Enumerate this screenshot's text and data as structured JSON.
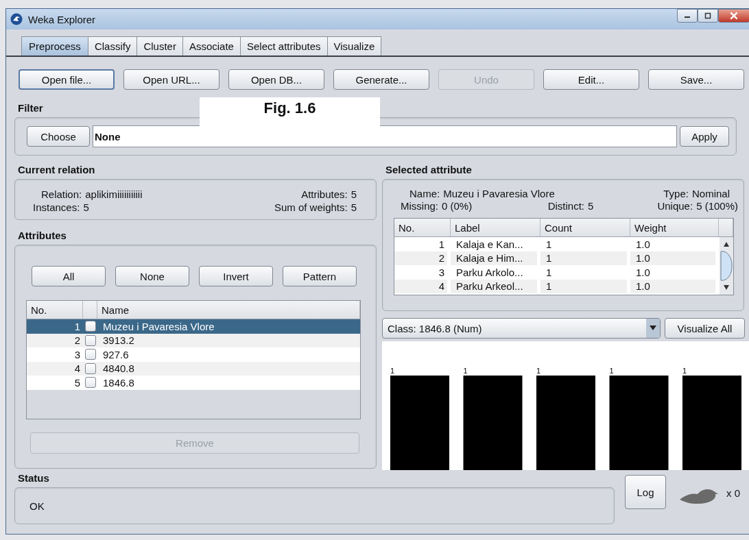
{
  "window": {
    "title": "Weka Explorer"
  },
  "tabs": [
    {
      "label": "Preprocess",
      "selected": true
    },
    {
      "label": "Classify",
      "selected": false
    },
    {
      "label": "Cluster",
      "selected": false
    },
    {
      "label": "Associate",
      "selected": false
    },
    {
      "label": "Select attributes",
      "selected": false
    },
    {
      "label": "Visualize",
      "selected": false
    }
  ],
  "toolbar_buttons": [
    {
      "label": "Open file...",
      "disabled": false
    },
    {
      "label": "Open URL...",
      "disabled": false
    },
    {
      "label": "Open DB...",
      "disabled": false
    },
    {
      "label": "Generate...",
      "disabled": false
    },
    {
      "label": "Undo",
      "disabled": true
    },
    {
      "label": "Edit...",
      "disabled": false
    },
    {
      "label": "Save...",
      "disabled": false
    }
  ],
  "figure_label": "Fig. 1.6",
  "filter": {
    "heading": "Filter",
    "choose_button": "Choose",
    "value": "None",
    "apply_button": "Apply"
  },
  "current_relation": {
    "heading": "Current relation",
    "fields": [
      {
        "label": "Relation:",
        "value": "aplikimiiiiiiiiiii"
      },
      {
        "label": "Attributes:",
        "value": "5"
      },
      {
        "label": "Instances:",
        "value": "5"
      },
      {
        "label": "Sum of weights:",
        "value": "5"
      }
    ]
  },
  "attributes": {
    "heading": "Attributes",
    "buttons": [
      "All",
      "None",
      "Invert",
      "Pattern"
    ],
    "columns": [
      "No.",
      "Name"
    ],
    "rows": [
      {
        "no": "1",
        "name": "Muzeu i Pavaresia Vlore",
        "checked": false,
        "selected": true
      },
      {
        "no": "2",
        "name": "3913.2",
        "checked": false,
        "selected": false
      },
      {
        "no": "3",
        "name": "927.6",
        "checked": false,
        "selected": false
      },
      {
        "no": "4",
        "name": "4840.8",
        "checked": false,
        "selected": false
      },
      {
        "no": "5",
        "name": "1846.8",
        "checked": false,
        "selected": false
      }
    ],
    "remove_button": {
      "label": "Remove",
      "disabled": true
    }
  },
  "selected_attribute": {
    "heading": "Selected attribute",
    "fields": [
      {
        "label": "Name:",
        "value": "Muzeu i Pavaresia Vlore"
      },
      {
        "label": "Type:",
        "value": "Nominal"
      },
      {
        "label": "Missing:",
        "value": "0 (0%)"
      },
      {
        "label": "Distinct:",
        "value": "5"
      },
      {
        "label": "Unique:",
        "value": "5 (100%)"
      }
    ],
    "columns": [
      "No.",
      "Label",
      "Count",
      "Weight"
    ],
    "rows": [
      [
        "1",
        "Kalaja e Kan...",
        "1",
        "1.0"
      ],
      [
        "2",
        "Kalaja e Him...",
        "1",
        "1.0"
      ],
      [
        "3",
        "Parku Arkolo...",
        "1",
        "1.0"
      ],
      [
        "4",
        "Parku Arkeol...",
        "1",
        "1.0"
      ]
    ]
  },
  "class_selector": {
    "value": "Class: 1846.8 (Num)",
    "visualize_all_button": "Visualize All"
  },
  "histogram": {
    "bar_labels": [
      "1",
      "1",
      "1",
      "1",
      "1"
    ]
  },
  "status": {
    "heading": "Status",
    "message": "OK",
    "log_button": "Log",
    "worker_count": "x 0"
  }
}
